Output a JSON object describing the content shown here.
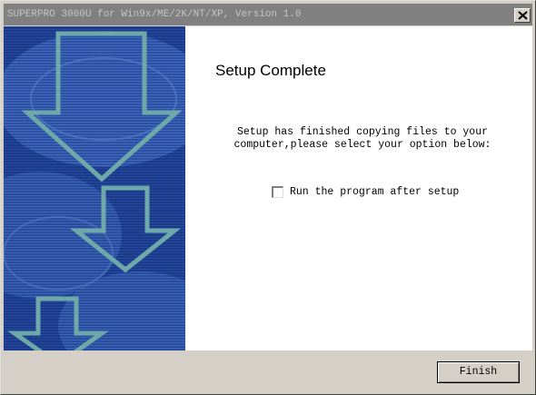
{
  "window": {
    "title": "SUPERPRO 3000U for Win9x/ME/2K/NT/XP, Version 1.0",
    "close_glyph": "×"
  },
  "icons": {
    "close": "close-icon",
    "banner_arrows": "down-arrow-icon"
  },
  "content": {
    "heading": "Setup Complete",
    "message_lines": [
      "Setup has finished copying files to your",
      "computer,please select your option below:"
    ],
    "option": {
      "label": "Run the program after setup",
      "checked": false
    }
  },
  "footer": {
    "finish_label": "Finish"
  },
  "colors": {
    "banner_blue": "#1a3a8a",
    "arrow_teal": "#6fa8a8",
    "titlebar_gray": "#808080",
    "face_gray": "#d4d0c8"
  }
}
